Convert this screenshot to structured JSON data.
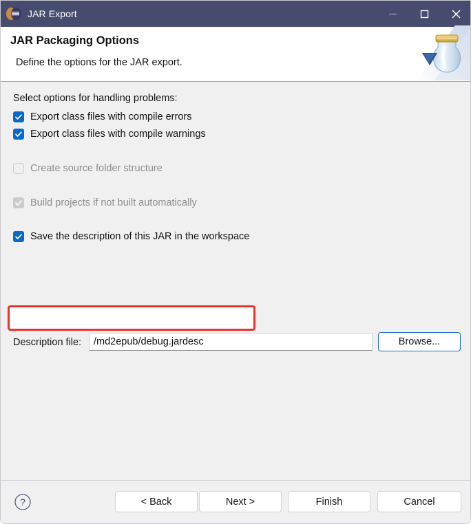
{
  "window": {
    "title": "JAR Export",
    "app_icon": "jar-export-icon",
    "controls": [
      {
        "name": "minimize-button",
        "glyph": "minimize-icon"
      },
      {
        "name": "maximize-button",
        "glyph": "maximize-icon"
      },
      {
        "name": "close-button",
        "glyph": "close-icon"
      }
    ],
    "titlebar_color": "#474c6e"
  },
  "header": {
    "title": "JAR Packaging Options",
    "subtitle": "Define the options for the JAR export.",
    "artwork_icon": "jar-banner-icon"
  },
  "main": {
    "section_label": "Select options for handling problems:",
    "options": [
      {
        "label": "Export class files with compile errors",
        "checked": true,
        "enabled": true,
        "name": "checkbox-export-compile-errors"
      },
      {
        "label": "Export class files with compile warnings",
        "checked": true,
        "enabled": true,
        "name": "checkbox-export-compile-warnings"
      },
      {
        "label": "Create source folder structure",
        "checked": false,
        "enabled": false,
        "name": "checkbox-create-source-folder-structure"
      },
      {
        "label": "Build projects if not built automatically",
        "checked": true,
        "enabled": false,
        "name": "checkbox-build-projects-if-not-built"
      },
      {
        "label": "Save the description of this JAR in the workspace",
        "checked": true,
        "enabled": true,
        "name": "checkbox-save-description-in-workspace",
        "highlighted": true
      }
    ],
    "description_file": {
      "label": "Description file:",
      "value": "/md2epub/debug.jardesc",
      "placeholder": "",
      "browse_label": "Browse..."
    },
    "highlight_color": "#e8342b",
    "accent_color": "#0a68c8"
  },
  "footer": {
    "help_icon": "help-icon",
    "buttons": [
      {
        "label": "< Back",
        "name": "back-button"
      },
      {
        "label": "Next >",
        "name": "next-button"
      },
      {
        "label": "Finish",
        "name": "finish-button"
      },
      {
        "label": "Cancel",
        "name": "cancel-button"
      }
    ]
  }
}
